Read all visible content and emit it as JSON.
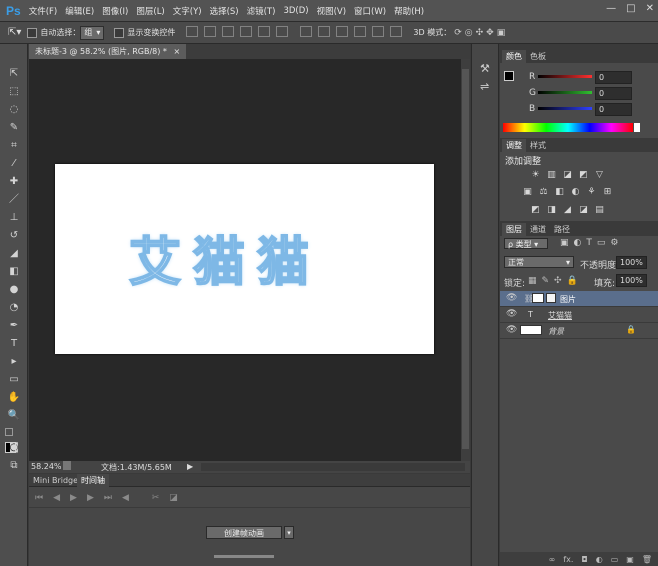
{
  "app": {
    "logo": "Ps"
  },
  "menu": {
    "items": [
      "文件(F)",
      "编辑(E)",
      "图像(I)",
      "图层(L)",
      "文字(Y)",
      "选择(S)",
      "滤镜(T)",
      "3D(D)",
      "视图(V)",
      "窗口(W)",
      "帮助(H)"
    ],
    "window_buttons": [
      "—",
      "□",
      "✕"
    ]
  },
  "options_bar": {
    "auto_select_label": "自动选择：",
    "auto_select_value": "组",
    "show_transform_label": "显示变换控件",
    "mode_3d_label": "3D 模式："
  },
  "document": {
    "tab_title": "未标题-3 @ 58.2% (图片, RGB/8) *",
    "canvas_text": "艾猫猫",
    "zoom": "58.24%",
    "doc_size": "文档:1.43M/5.65M"
  },
  "bottom_panel": {
    "tabs": [
      "Mini Bridge",
      "时间轴"
    ],
    "create_button": "创建帧动画"
  },
  "color_panel": {
    "tabs": [
      "颜色",
      "色板"
    ],
    "channels": [
      {
        "label": "R",
        "value": "0",
        "color": "#ff3030"
      },
      {
        "label": "G",
        "value": "0",
        "color": "#30c030"
      },
      {
        "label": "B",
        "value": "0",
        "color": "#3040ff"
      }
    ]
  },
  "adjust_panel": {
    "tabs": [
      "调整",
      "样式"
    ],
    "title": "添加调整",
    "icons_row1": [
      "☀",
      "▥",
      "◪",
      "◩",
      "▽"
    ],
    "icons_row2": [
      "▣",
      "⚖",
      "◧",
      "◐",
      "⚘",
      "⊞"
    ],
    "icons_row3": [
      "◩",
      "◨",
      "◢",
      "◪",
      "▤"
    ]
  },
  "layers_panel": {
    "tabs": [
      "图层",
      "通道",
      "路径"
    ],
    "filter_label": "ρ 类型",
    "blend_mode": "正常",
    "opacity_label": "不透明度:",
    "opacity_value": "100%",
    "lock_label": "锁定:",
    "fill_label": "填充:",
    "fill_value": "100%",
    "layers": [
      {
        "name": "图片",
        "type": "image",
        "selected": true
      },
      {
        "name": "艾猫猫",
        "type": "text",
        "selected": false
      },
      {
        "name": "背景",
        "type": "background",
        "selected": false
      }
    ],
    "bottom_icons": [
      "∞",
      "fx.",
      "◘",
      "◐",
      "▭",
      "▣",
      "🗑"
    ]
  },
  "colors": {
    "menubar": "#535353",
    "canvas": "#282828",
    "selected_layer": "#5a6e8c",
    "logo": "#3a9ee8"
  }
}
